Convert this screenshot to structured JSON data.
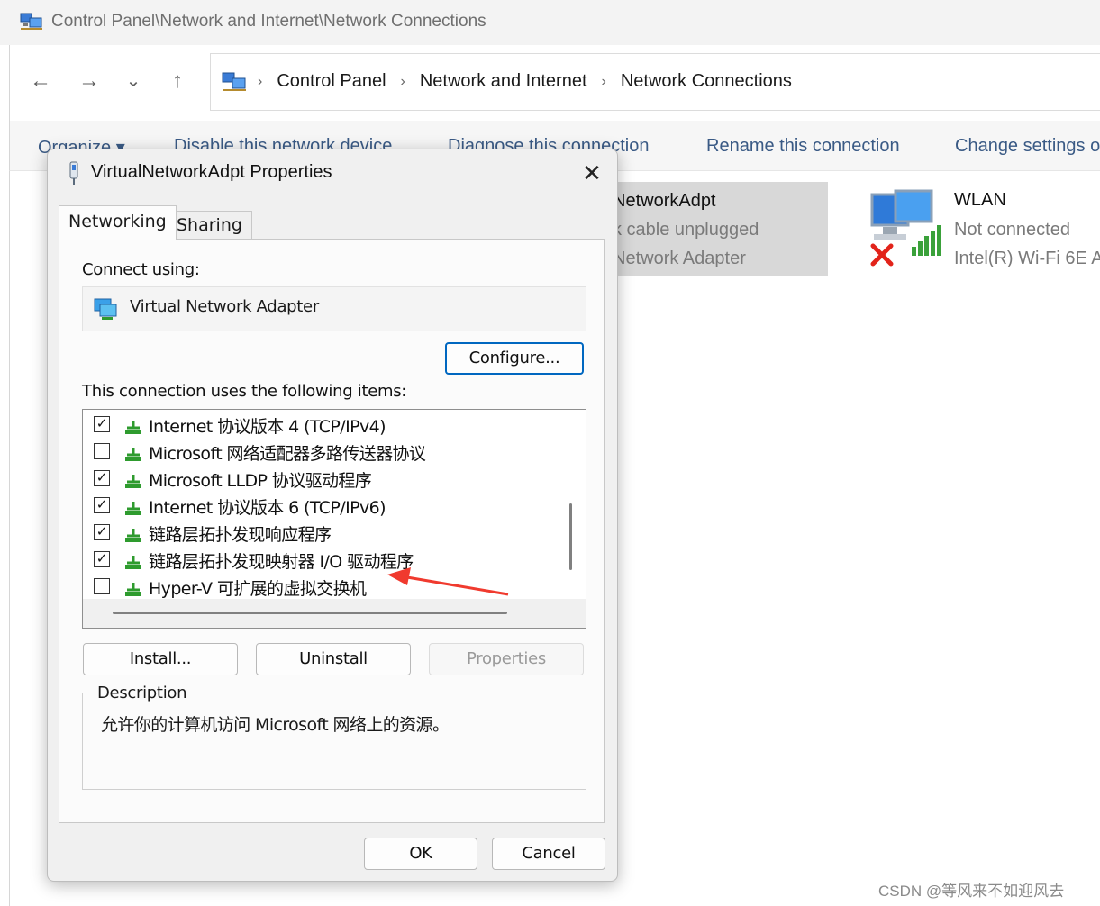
{
  "window": {
    "title": "Control Panel\\Network and Internet\\Network Connections"
  },
  "nav": {
    "back": "←",
    "forward": "→",
    "recent": "⌄",
    "up": "↑"
  },
  "breadcrumb": [
    "Control Panel",
    "Network and Internet",
    "Network Connections"
  ],
  "breadcrumb_sep": "›",
  "commands": {
    "organize": "Organize ▾",
    "disable": "Disable this network device",
    "diagnose": "Diagnose this connection",
    "rename": "Rename this connection",
    "change": "Change settings o"
  },
  "connections": {
    "virtual": {
      "name": "NetworkAdpt",
      "status": "k cable unplugged",
      "device": "Network Adapter"
    },
    "wlan": {
      "name": "WLAN",
      "status": "Not connected",
      "device": "Intel(R) Wi-Fi 6E A"
    }
  },
  "dialog": {
    "title": "VirtualNetworkAdpt Properties",
    "close": "✕",
    "tabs": {
      "networking": "Networking",
      "sharing": "Sharing"
    },
    "connect_using_label": "Connect using:",
    "adapter": "Virtual Network Adapter",
    "configure": "Configure...",
    "items_label": "This connection uses the following items:",
    "items": [
      {
        "label": "Internet 协议版本 4 (TCP/IPv4)",
        "checked": true,
        "mark": "✓"
      },
      {
        "label": "Microsoft 网络适配器多路传送器协议",
        "checked": false,
        "mark": ""
      },
      {
        "label": "Microsoft LLDP 协议驱动程序",
        "checked": true,
        "mark": "✓"
      },
      {
        "label": "Internet 协议版本 6 (TCP/IPv6)",
        "checked": true,
        "mark": "✓"
      },
      {
        "label": "链路层拓扑发现响应程序",
        "checked": true,
        "mark": "✓"
      },
      {
        "label": "链路层拓扑发现映射器 I/O 驱动程序",
        "checked": true,
        "mark": "✓"
      },
      {
        "label": "Hyper-V 可扩展的虚拟交换机",
        "checked": false,
        "mark": ""
      }
    ],
    "install": "Install...",
    "uninstall": "Uninstall",
    "properties": "Properties",
    "description_label": "Description",
    "description": "允许你的计算机访问 Microsoft 网络上的资源。",
    "ok": "OK",
    "cancel": "Cancel"
  },
  "watermark": "CSDN @等风来不如迎风去",
  "colors": {
    "accent": "#0067c0",
    "command_text": "#3a5a85",
    "arrow": "#f03a2e"
  }
}
